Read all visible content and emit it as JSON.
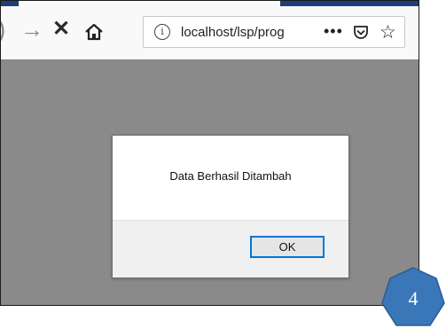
{
  "browser": {
    "nav": {
      "back_glyph": ")",
      "forward_glyph": "→",
      "stop_glyph": "✕",
      "home_icon": "home-icon"
    },
    "urlbar": {
      "info_glyph": "i",
      "url": "localhost/lsp/prog",
      "more_glyph": "•••",
      "pocket_icon": "pocket-icon",
      "star_glyph": "☆"
    }
  },
  "dialog": {
    "message": "Data Berhasil Ditambah",
    "ok_label": "OK"
  },
  "badge": {
    "number": "4",
    "color": "#3a77b8"
  },
  "colors": {
    "overlay": "#8a8a8a",
    "toolbar": "#f9f9fa",
    "accent_focus": "#0078d7"
  }
}
